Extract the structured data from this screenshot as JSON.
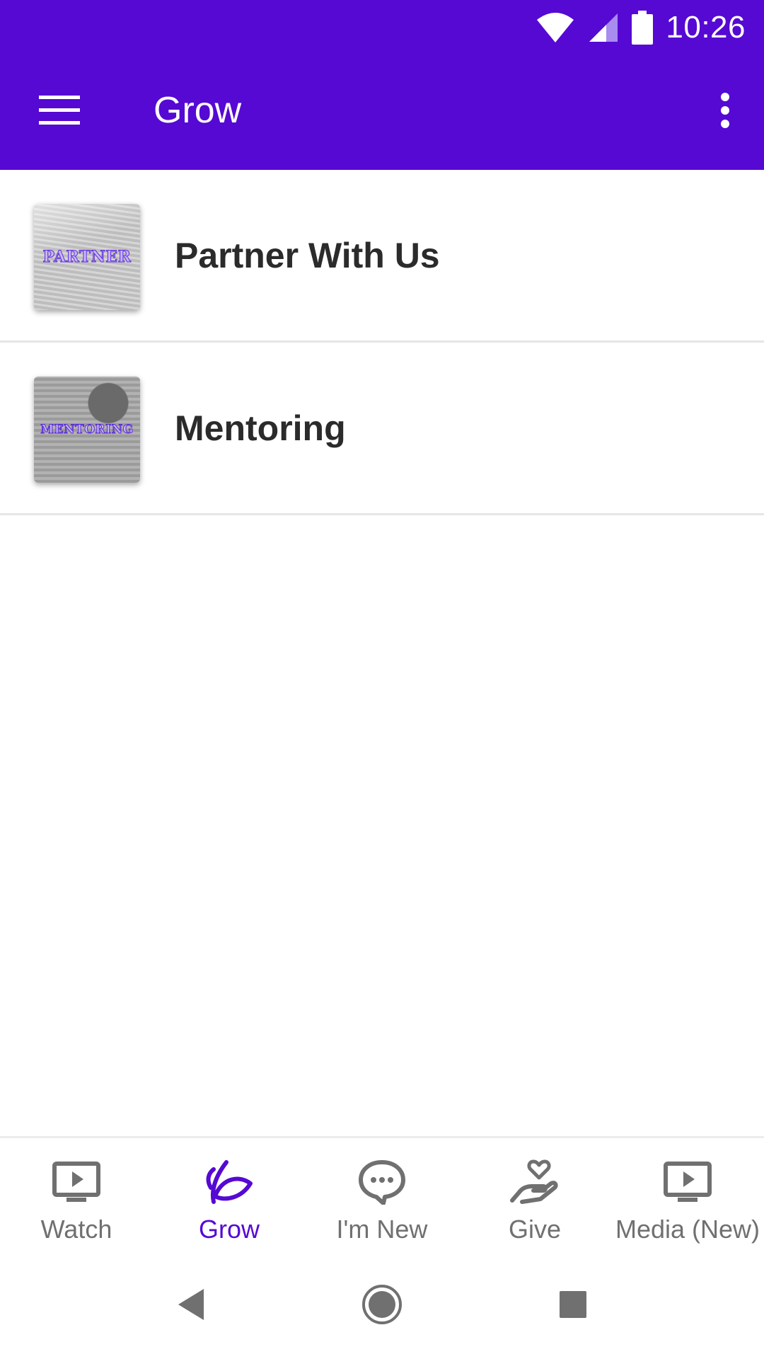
{
  "status_bar": {
    "time": "10:26",
    "icons": [
      "wifi-icon",
      "cell-signal-icon",
      "battery-icon"
    ]
  },
  "app_bar": {
    "title": "Grow",
    "menu_icon": "hamburger-menu-icon",
    "overflow_icon": "more-vert-icon",
    "background_color": "#5509d3"
  },
  "list": {
    "items": [
      {
        "label": "Partner With Us",
        "thumbnail_text": "PARTNER"
      },
      {
        "label": "Mentoring",
        "thumbnail_text": "MENTORING"
      }
    ]
  },
  "bottom_nav": {
    "active_color": "#5509d3",
    "inactive_color": "#707070",
    "items": [
      {
        "label": "Watch",
        "icon": "tv-play-icon",
        "active": false
      },
      {
        "label": "Grow",
        "icon": "leaf-icon",
        "active": true
      },
      {
        "label": "I'm New",
        "icon": "chat-bubble-icon",
        "active": false
      },
      {
        "label": "Give",
        "icon": "hand-heart-icon",
        "active": false
      },
      {
        "label": "Media (New)",
        "icon": "tv-play-icon",
        "active": false
      }
    ]
  },
  "system_nav": {
    "buttons": [
      "back-icon",
      "home-icon",
      "recents-icon"
    ]
  }
}
